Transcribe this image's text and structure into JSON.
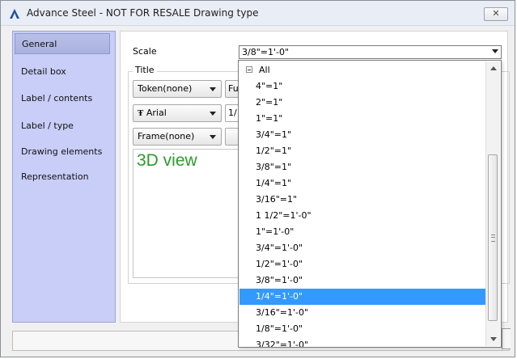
{
  "window": {
    "title": "Advance Steel - NOT FOR RESALE  Drawing type",
    "close_icon": "close-icon"
  },
  "sidebar": {
    "items": [
      {
        "label": "General",
        "selected": true
      },
      {
        "label": "Detail box",
        "selected": false
      },
      {
        "label": "Label / contents",
        "selected": false
      },
      {
        "label": "Label / type",
        "selected": false
      },
      {
        "label": "Drawing elements",
        "selected": false
      },
      {
        "label": "Representation",
        "selected": false
      }
    ]
  },
  "general": {
    "scale_label": "Scale",
    "scale_value": "3/8\"=1'-0\"",
    "title_group_label": "Title",
    "token_value": "Token(none)",
    "token_second": "Fu",
    "font_icon": "font-type-icon",
    "font_glyph": "Ŧ",
    "font_value": "Arial",
    "font_second": "1/",
    "frame_value": "Frame(none)",
    "preview_text": "3D view"
  },
  "dropdown": {
    "root_label": "All",
    "items": [
      "4\"=1\"",
      "2\"=1\"",
      "1\"=1\"",
      "3/4\"=1\"",
      "1/2\"=1\"",
      "3/8\"=1\"",
      "1/4\"=1\"",
      "3/16\"=1\"",
      "1 1/2\"=1'-0\"",
      "1\"=1'-0\"",
      "3/4\"=1'-0\"",
      "1/2\"=1'-0\"",
      "3/8\"=1'-0\"",
      "1/4\"=1'-0\"",
      "3/16\"=1'-0\"",
      "1/8\"=1'-0\"",
      "3/32\"=1'-0\""
    ],
    "selected_index": 13
  },
  "colors": {
    "sidebar_bg": "#c9cef8",
    "selection": "#3399ff",
    "preview_text": "#2c9b2c"
  }
}
